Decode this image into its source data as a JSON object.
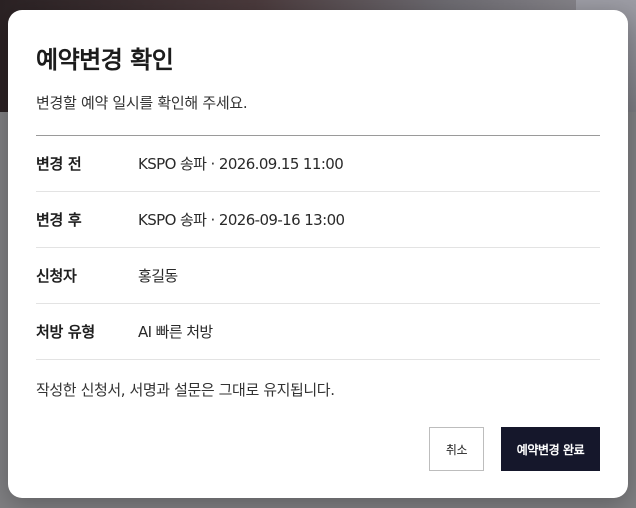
{
  "modal": {
    "title": "예약변경 확인",
    "subtitle": "변경할 예약 일시를 확인해 주세요.",
    "details": [
      {
        "label": "변경 전",
        "value": "KSPO 송파 · 2026.09.15 11:00"
      },
      {
        "label": "변경 후",
        "value": "KSPO 송파 · 2026-09-16 13:00"
      },
      {
        "label": "신청자",
        "value": "홍길동"
      },
      {
        "label": "처방 유형",
        "value": "AI 빠른 처방"
      }
    ],
    "notice": "작성한 신청서, 서명과 설문은 그대로 유지됩니다.",
    "buttons": {
      "cancel_label": "취소",
      "confirm_label": "예약변경 완료"
    }
  },
  "colors": {
    "confirm_button_bg": "#15172b",
    "overlay": "#7f7f82"
  }
}
